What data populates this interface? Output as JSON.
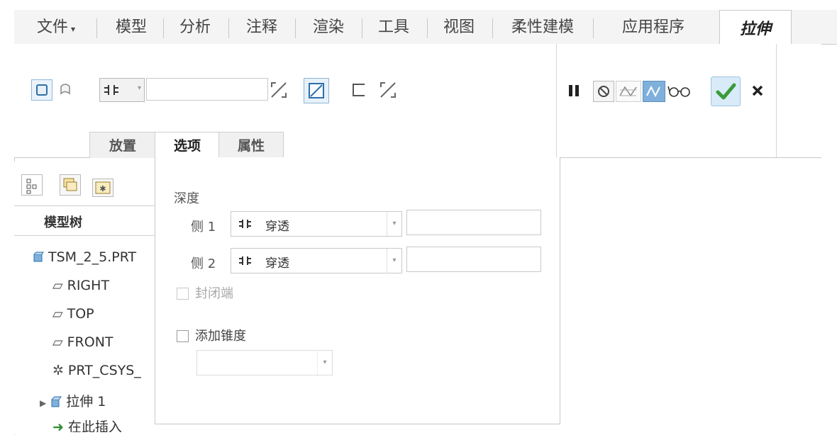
{
  "menu": {
    "file": "文件",
    "file_arrow": "▾",
    "tabs": [
      "模型",
      "分析",
      "注释",
      "渲染",
      "工具",
      "视图",
      "柔性建模",
      "应用程序"
    ],
    "active_tab": "拉伸"
  },
  "ribbon": {
    "depth_value": "",
    "subtabs": [
      "放置",
      "选项",
      "属性"
    ],
    "controls_icons": [
      "pause-icon",
      "no-preview-icon",
      "geometry-preview-icon",
      "feature-preview-icon",
      "glasses-icon"
    ]
  },
  "model_tree": {
    "title": "模型树",
    "items": [
      "TSM_2_5.PRT",
      "RIGHT",
      "TOP",
      "FRONT",
      "PRT_CSYS_",
      "拉伸 1",
      "在此插入"
    ]
  },
  "options": {
    "depth_label": "深度",
    "side1_label": "侧 1",
    "side1_value": "穿透",
    "side2_label": "侧 2",
    "side2_value": "穿透",
    "capped_ends_label": "封闭端",
    "add_taper_label": "添加锥度",
    "taper_value": ""
  },
  "colors": {
    "accent": "#2f8fcf",
    "ok_check": "#3a9c3a"
  }
}
